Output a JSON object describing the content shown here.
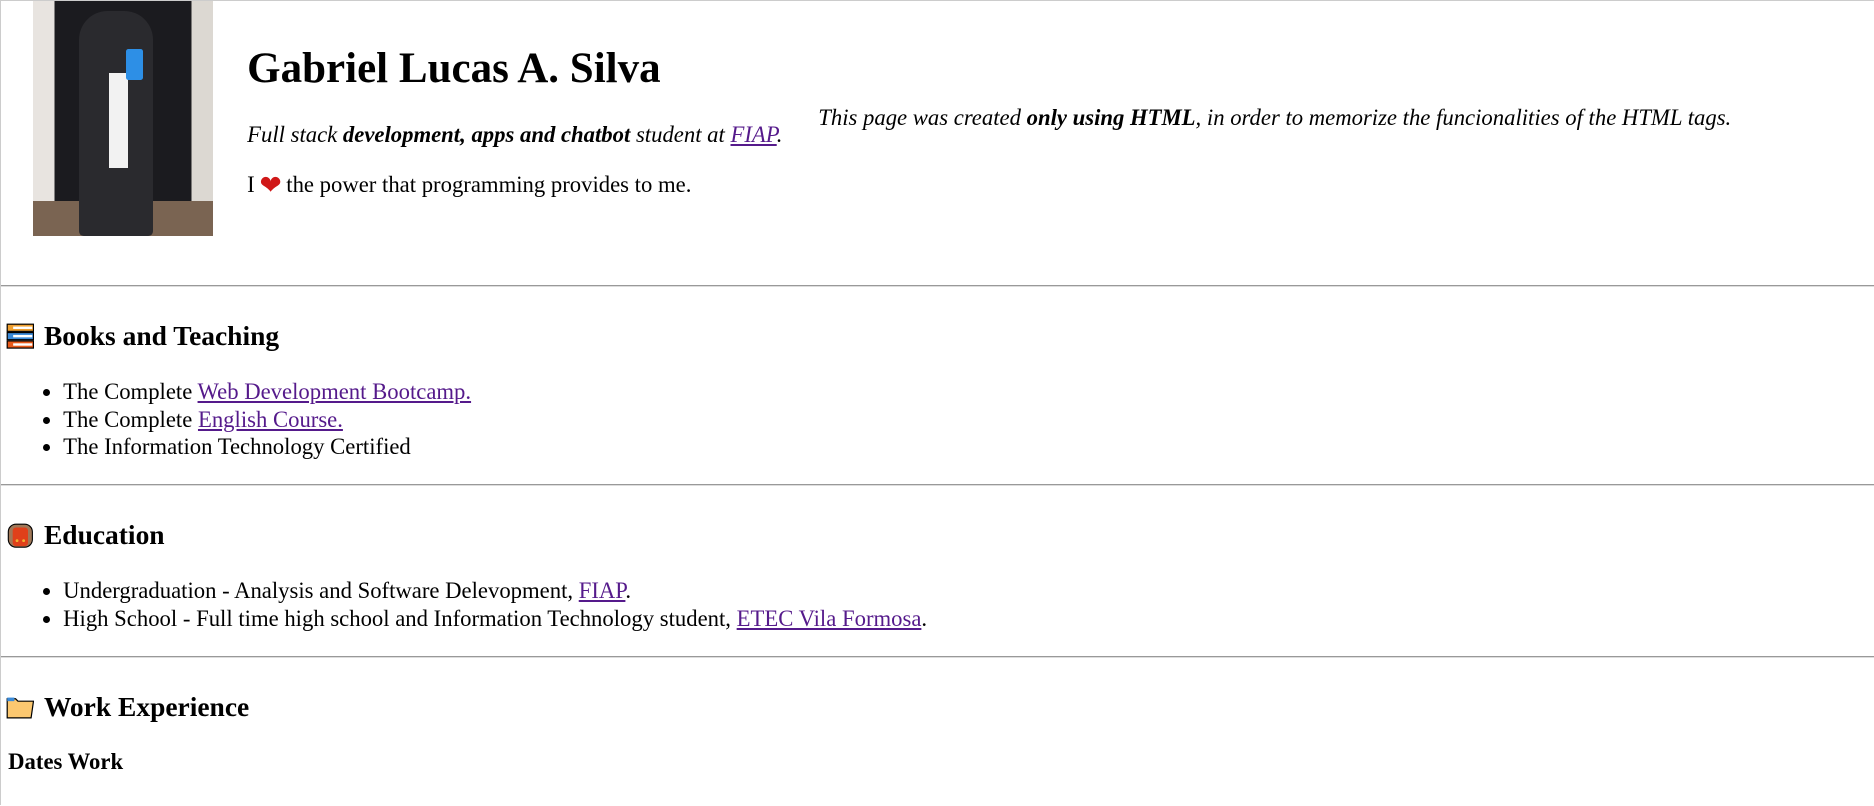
{
  "header": {
    "name": "Gabriel Lucas A. Silva",
    "tagline": {
      "pre": "Full stack ",
      "bold": "development, apps and chatbot",
      "mid": " student at ",
      "link": "FIAP",
      "post": "."
    },
    "love": {
      "pre": "I",
      "icon": "heart-icon",
      "post": "the power that programming provides to me."
    },
    "note": {
      "pre": "This page was created ",
      "bold": "only using HTML",
      "post": ", in order to memorize the funcionalities of the HTML tags."
    }
  },
  "books": {
    "title": "Books and Teaching",
    "items": [
      {
        "text": "The Complete ",
        "link": "Web Development Bootcamp."
      },
      {
        "text": "The Complete ",
        "link": "English Course."
      },
      {
        "text": "The Information Technology Certified"
      }
    ]
  },
  "education": {
    "title": "Education",
    "items": [
      {
        "text": "Undergraduation - Analysis and Software Delevopment, ",
        "link": "FIAP",
        "post": "."
      },
      {
        "text": "High School - Full time high school and Information Technology student, ",
        "link": "ETEC Vila Formosa",
        "post": "."
      }
    ]
  },
  "work": {
    "title": "Work Experience",
    "subtitle": "Dates Work"
  }
}
